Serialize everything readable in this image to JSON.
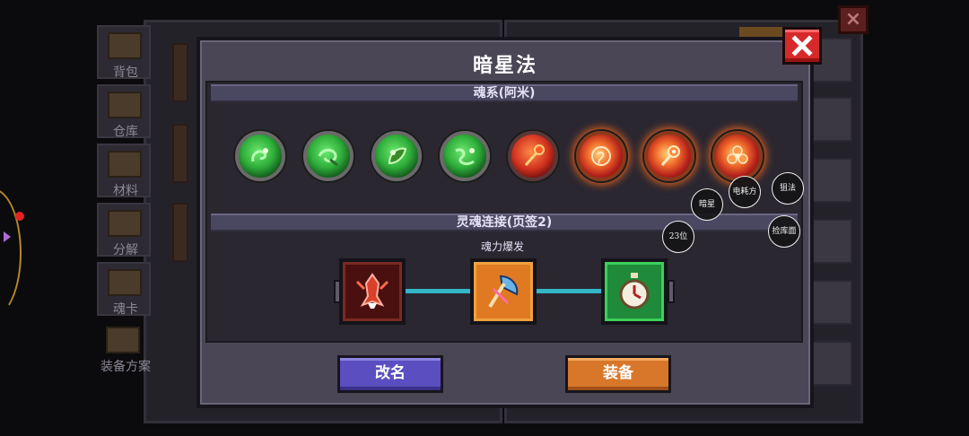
{
  "background": {
    "sidebar": [
      {
        "label": "背包"
      },
      {
        "label": "仓库"
      },
      {
        "label": "材料"
      },
      {
        "label": "分解"
      },
      {
        "label": "魂卡"
      },
      {
        "label": "装备方案"
      }
    ]
  },
  "dialog": {
    "title": "暗星法",
    "section1_title": "魂系(阿米)",
    "section2_title": "灵魂连接(页签2)",
    "link_skill_label": "魂力爆发",
    "orbs": [
      {
        "type": "green",
        "icon": "green-serpent-icon"
      },
      {
        "type": "green",
        "icon": "green-swirl-icon"
      },
      {
        "type": "green",
        "icon": "green-leaf-icon"
      },
      {
        "type": "green",
        "icon": "green-vine-icon"
      },
      {
        "type": "red",
        "icon": "red-staff-icon"
      },
      {
        "type": "fire",
        "icon": "fire-rune-icon"
      },
      {
        "type": "fire",
        "icon": "fire-scepter-icon"
      },
      {
        "type": "fire",
        "icon": "fire-flower-icon"
      }
    ],
    "link_slots": [
      {
        "icon": "crimson-beast-icon"
      },
      {
        "icon": "blue-axe-icon"
      },
      {
        "icon": "stopwatch-icon"
      }
    ],
    "buttons": {
      "rename": "改名",
      "equip": "装备"
    },
    "close_icon": "close-x-icon"
  },
  "annotations": [
    {
      "text": "暗星"
    },
    {
      "text": "电耗方"
    },
    {
      "text": "狙法"
    },
    {
      "text": "23位"
    },
    {
      "text": "捡库面"
    }
  ],
  "colors": {
    "dialog_bg": "#4a4656",
    "inner_bg": "#2a2731",
    "rename_button": "#5a4ec0",
    "equip_button": "#d8772a",
    "close_button": "#d62a2a",
    "connector": "#35b5c8"
  }
}
